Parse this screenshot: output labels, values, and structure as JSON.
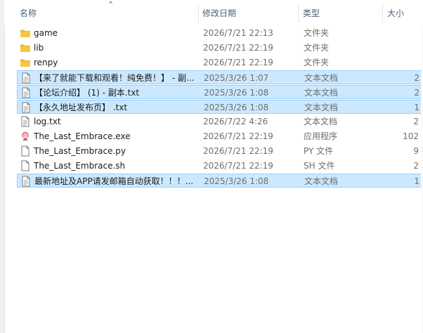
{
  "columns": {
    "name": "名称",
    "date": "修改日期",
    "type": "类型",
    "size": "大小"
  },
  "colors": {
    "selection_bg": "#cce8ff",
    "selection_border": "#99d1ff",
    "folder": "#f0c233",
    "header_text": "#4c607a"
  },
  "files": [
    {
      "name": "game",
      "date": "2026/7/21 22:13",
      "type": "文件夹",
      "size": "",
      "icon": "folder-icon",
      "selected": false
    },
    {
      "name": "lib",
      "date": "2026/7/21 22:19",
      "type": "文件夹",
      "size": "",
      "icon": "folder-icon",
      "selected": false
    },
    {
      "name": "renpy",
      "date": "2026/7/21 22:19",
      "type": "文件夹",
      "size": "",
      "icon": "folder-icon",
      "selected": false
    },
    {
      "name": "【来了就能下载和观看！纯免费！】 - 副...",
      "date": "2025/3/26 1:07",
      "type": "文本文档",
      "size": "2",
      "icon": "text-file-icon",
      "selected": true
    },
    {
      "name": "【论坛介绍】 (1) - 副本.txt",
      "date": "2025/3/26 1:08",
      "type": "文本文档",
      "size": "2",
      "icon": "text-file-icon",
      "selected": true
    },
    {
      "name": "【永久地址发布页】 .txt",
      "date": "2025/3/26 1:08",
      "type": "文本文档",
      "size": "1",
      "icon": "text-file-icon",
      "selected": true
    },
    {
      "name": "log.txt",
      "date": "2026/7/22 4:26",
      "type": "文本文档",
      "size": "2",
      "icon": "text-file-icon",
      "selected": false
    },
    {
      "name": "The_Last_Embrace.exe",
      "date": "2026/7/21 22:19",
      "type": "应用程序",
      "size": "102",
      "icon": "app-exe-icon",
      "selected": false
    },
    {
      "name": "The_Last_Embrace.py",
      "date": "2026/7/21 22:19",
      "type": "PY 文件",
      "size": "9",
      "icon": "blank-file-icon",
      "selected": false
    },
    {
      "name": "The_Last_Embrace.sh",
      "date": "2026/7/21 22:19",
      "type": "SH 文件",
      "size": "2",
      "icon": "blank-file-icon",
      "selected": false
    },
    {
      "name": "最新地址及APP请发邮箱自动获取！！！...",
      "date": "2025/3/26 1:08",
      "type": "文本文档",
      "size": "1",
      "icon": "text-file-icon",
      "selected": true
    }
  ]
}
